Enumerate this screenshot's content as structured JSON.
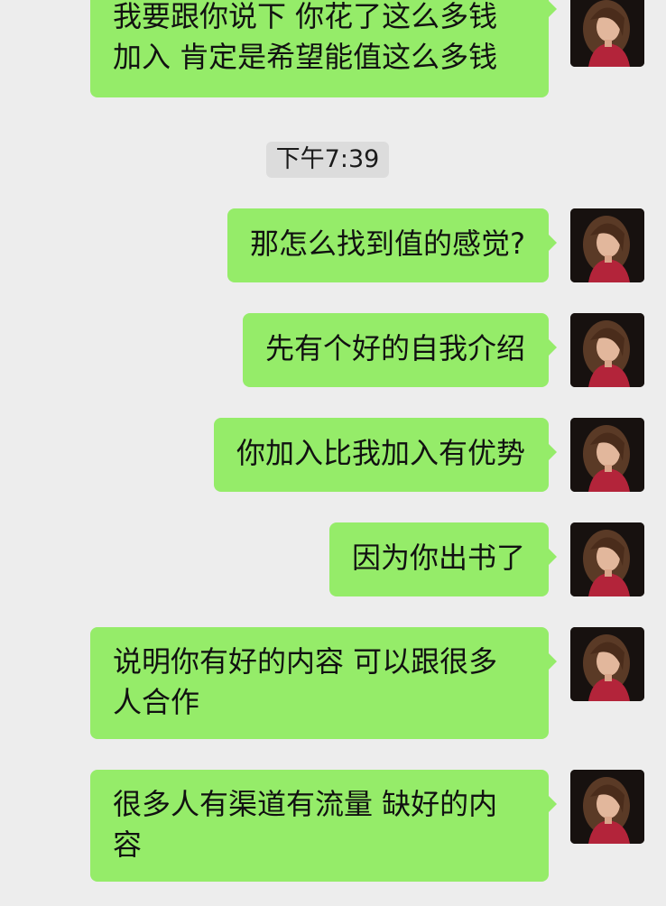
{
  "timestamp": "下午7:39",
  "messages": [
    {
      "text": "我要跟你说下 你花了这么多钱加入 肯定是希望能值这么多钱"
    },
    {
      "text": "那怎么找到值的感觉?"
    },
    {
      "text": "先有个好的自我介绍"
    },
    {
      "text": "你加入比我加入有优势"
    },
    {
      "text": "因为你出书了"
    },
    {
      "text": "说明你有好的内容 可以跟很多人合作"
    },
    {
      "text": "很多人有渠道有流量 缺好的内容"
    }
  ],
  "colors": {
    "background": "#ededed",
    "outgoing_bubble": "#95ec69",
    "timestamp_bg": "#dcdcdc"
  },
  "icons": {
    "avatar": "user-avatar-photo"
  }
}
